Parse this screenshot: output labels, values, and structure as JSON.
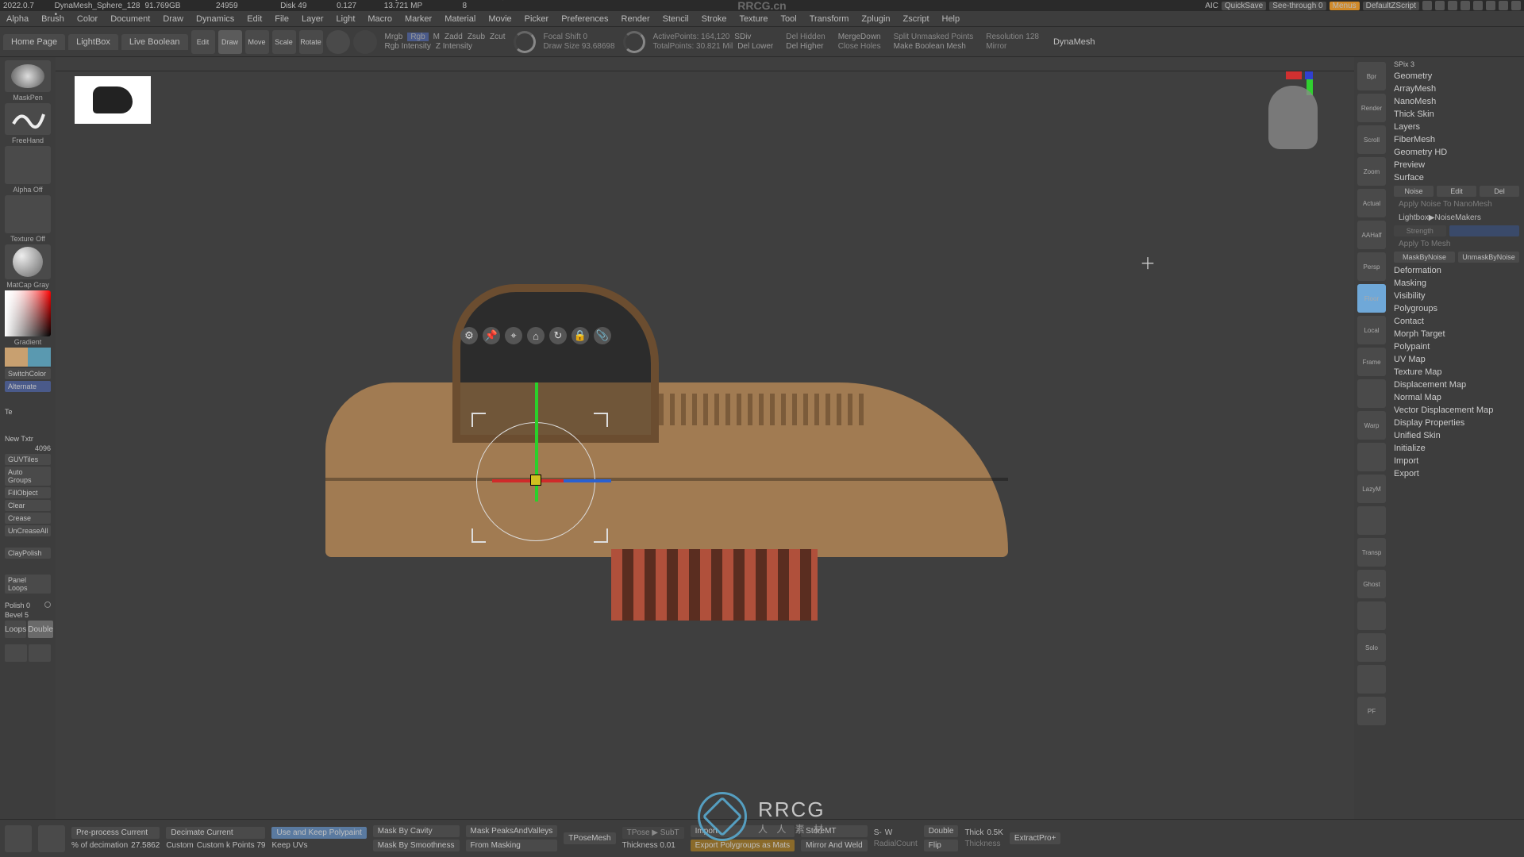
{
  "titlebar": {
    "app": "ZBrush 2022.0.7",
    "project": "DynaMesh_Sphere_128",
    "freemem": "Free Mem 91.769GB",
    "activemem": "Active Mem 24959",
    "scratch": "Scratch Disk 49",
    "timer": "Timer: 0.127",
    "polycount": "PolyCount▶ 13.721 MP",
    "meshcount": "MeshCount▶ 8",
    "centerbrand": "RRCG.cn",
    "aic": "AIC",
    "quicksave": "QuickSave",
    "seethrough": "See-through  0",
    "menus": "Menus",
    "defscript": "DefaultZScript"
  },
  "menus": [
    "Alpha",
    "Brush",
    "Color",
    "Document",
    "Draw",
    "Dynamics",
    "Edit",
    "File",
    "Layer",
    "Light",
    "Macro",
    "Marker",
    "Material",
    "Movie",
    "Picker",
    "Preferences",
    "Render",
    "Stencil",
    "Stroke",
    "Texture",
    "Tool",
    "Transform",
    "Zplugin",
    "Zscript",
    "Help"
  ],
  "tabs": {
    "home": "Home Page",
    "lightbox": "LightBox",
    "liveboolean": "Live Boolean"
  },
  "shelf": {
    "edit": "Edit",
    "draw": "Draw",
    "move": "Move",
    "scale": "Scale",
    "rotate": "Rotate",
    "mrgb": "Mrgb",
    "rgb": "Rgb",
    "m": "M",
    "zadd": "Zadd",
    "zsub": "Zsub",
    "zcut": "Zcut",
    "rgbint": "Rgb Intensity",
    "zint": "Z Intensity",
    "focal_lbl": "Focal Shift 0",
    "drawsize_lbl": "Draw Size 93.68698",
    "active_lbl": "ActivePoints: 164,120",
    "total_lbl": "TotalPoints: 30.821 Mil",
    "sdiv": "SDiv",
    "dellower": "Del Lower",
    "delhidden": "Del Hidden",
    "delhigher": "Del Higher",
    "mergedown": "MergeDown",
    "closeholes": "Close Holes",
    "makebool": "Make Boolean Mesh",
    "splitunmask": "Split Unmasked Points",
    "mirror": "Mirror",
    "resolution": "Resolution 128",
    "dynamesh": "DynaMesh"
  },
  "left": {
    "brush_name": "MaskPen",
    "stroke_name": "FreeHand",
    "alpha": "Alpha Off",
    "texture": "Texture Off",
    "material": "MatCap Gray",
    "gradient": "Gradient",
    "switchcolor": "SwitchColor",
    "alternate": "Alternate",
    "te": "Te",
    "newtxtr": "New Txtr",
    "newtxtr_val": "4096",
    "guvtiles": "GUVTiles",
    "autogroups": "Auto Groups",
    "fillobject": "FillObject",
    "clear": "Clear",
    "crease": "Crease",
    "uncrease": "UnCreaseAll",
    "claypolish": "ClayPolish",
    "panelloops": "Panel Loops",
    "polish": "Polish 0",
    "bevel": "Bevel 5",
    "loops": "Loops",
    "double": "Double",
    "sw1": "#c8a070",
    "sw2": "#5a99b0"
  },
  "mid_icons": [
    "Bpr",
    "Render",
    "Scroll",
    "Zoom",
    "Actual",
    "AAHalf",
    "Persp",
    "Floor",
    "Local",
    "Frame",
    "",
    "Warp",
    "",
    "LazyM",
    "",
    "Transp",
    "Ghost",
    "",
    "Solo",
    "",
    "PF"
  ],
  "mid_active_index": 7,
  "right": {
    "spix": "SPix 3",
    "sections": [
      "Geometry",
      "ArrayMesh",
      "NanoMesh",
      "Thick Skin",
      "Layers",
      "FiberMesh",
      "Geometry HD",
      "Preview",
      "Surface"
    ],
    "noise_row": {
      "noise": "Noise",
      "edit": "Edit",
      "del": "Del"
    },
    "applynoise": "Apply Noise To NanoMesh",
    "lightbox_noise": "Lightbox▶NoiseMakers",
    "strength": "Strength",
    "strength_val": "",
    "applytomesh": "Apply To Mesh",
    "maskbynoise": "MaskByNoise",
    "unmaskbynoise": "UnmaskByNoise",
    "more": [
      "Deformation",
      "Masking",
      "Visibility",
      "Polygroups",
      "Contact",
      "Morph Target",
      "Polypaint",
      "UV Map",
      "Texture Map",
      "Displacement Map",
      "Normal Map",
      "Vector Displacement Map",
      "Display Properties",
      "Unified Skin",
      "Initialize",
      "Import",
      "Export"
    ]
  },
  "gizmo_icons": [
    "gear",
    "pin",
    "locate",
    "home",
    "reset",
    "lock",
    "sticky"
  ],
  "bottom": {
    "preprocess": "Pre-process Current",
    "pod": "% of decimation",
    "pod_val": "27.5862",
    "decimate": "Decimate Current",
    "custom": "Custom",
    "custom_k": "Custom k Points 79",
    "keeppoly": "Use and Keep Polypaint",
    "keepuv": "Keep UVs",
    "maskcavity": "Mask By Cavity",
    "masksmooth": "Mask By Smoothness",
    "maskpv": "Mask PeaksAndValleys",
    "frommask": "From Masking",
    "tpose": "TPoseMesh",
    "tposesub": "TPose ▶ SubT",
    "import": "Import",
    "exportpoly": "Export Polygroups as Mats",
    "storemt": "StoreMT",
    "mirrorweld": "Mirror And Weld",
    "sminus": "S-",
    "w": "W",
    "radial": "RadialCount",
    "double": "Double",
    "flip": "Flip",
    "thick": "Thick",
    "thick_val": "0.5K",
    "thickness": "Thickness",
    "extract": "ExtractPro+",
    "thickness2": "Thickness 0.01"
  },
  "watermark": {
    "big": "RRCG",
    "sub": "人 人 素 材"
  }
}
